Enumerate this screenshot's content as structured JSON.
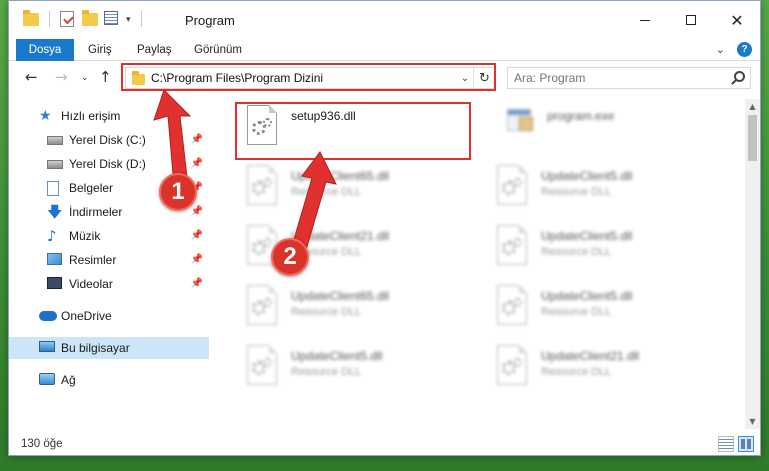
{
  "window": {
    "title": "Program",
    "min_icon": "minimize-icon",
    "max_icon": "maximize-icon",
    "close_icon": "close-icon"
  },
  "ribbon": {
    "tabs": [
      "Dosya",
      "Giriş",
      "Paylaş",
      "Görünüm"
    ],
    "accent": "#1979ca"
  },
  "nav": {
    "address": "C:\\Program Files\\Program Dizini",
    "search_placeholder": "Ara: Program"
  },
  "sidebar": {
    "items": [
      {
        "label": "Hızlı erişim",
        "icon": "star-icon"
      },
      {
        "label": "Yerel Disk (C:)",
        "icon": "disk-icon",
        "pinned": true
      },
      {
        "label": "Yerel Disk (D:)",
        "icon": "disk-icon",
        "pinned": true
      },
      {
        "label": "Belgeler",
        "icon": "document-icon",
        "pinned": true
      },
      {
        "label": "İndirmeler",
        "icon": "download-icon",
        "pinned": true
      },
      {
        "label": "Müzik",
        "icon": "music-icon",
        "pinned": true
      },
      {
        "label": "Resimler",
        "icon": "pictures-icon",
        "pinned": true
      },
      {
        "label": "Videolar",
        "icon": "videos-icon",
        "pinned": true
      },
      {
        "label": "OneDrive",
        "icon": "cloud-icon"
      },
      {
        "label": "Bu bilgisayar",
        "icon": "computer-icon",
        "selected": true
      },
      {
        "label": "Ağ",
        "icon": "network-icon"
      }
    ]
  },
  "files": [
    {
      "name": "setup936.dll",
      "type": "",
      "highlight": true
    },
    {
      "name": "program.exe",
      "type": "",
      "blurred": true
    },
    {
      "name": "UpdateClient65.dll",
      "type": "Resource DLL",
      "blurred": true
    },
    {
      "name": "UpdateClient5.dll",
      "type": "Resource DLL",
      "blurred": true
    },
    {
      "name": "UpdateClient21.dll",
      "type": "Resource DLL",
      "blurred": true
    },
    {
      "name": "UpdateClient5.dll",
      "type": "Resource DLL",
      "blurred": true
    },
    {
      "name": "UpdateClient65.dll",
      "type": "Resource DLL",
      "blurred": true
    },
    {
      "name": "UpdateClient5.dll",
      "type": "Resource DLL",
      "blurred": true
    },
    {
      "name": "UpdateClient5.dll",
      "type": "Resource DLL",
      "blurred": true
    },
    {
      "name": "UpdateClient21.dll",
      "type": "Resource DLL",
      "blurred": true
    }
  ],
  "status": {
    "count": "130 öğe"
  },
  "annotations": {
    "step1": "1",
    "step2": "2",
    "color": "#e0302f"
  }
}
